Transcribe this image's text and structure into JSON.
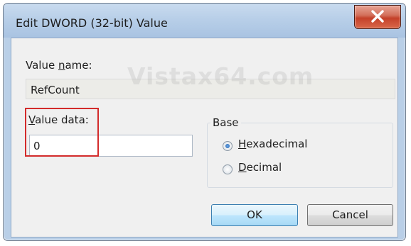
{
  "dialog": {
    "title": "Edit DWORD (32-bit) Value",
    "close_icon": "close-x-icon"
  },
  "value_name": {
    "label_pre": "Value ",
    "label_u": "n",
    "label_post": "ame:",
    "value": "RefCount"
  },
  "watermark": "Vistax64.com",
  "value_data": {
    "label_u": "V",
    "label_post": "alue data:",
    "value": "0"
  },
  "base": {
    "legend": "Base",
    "options": [
      {
        "u": "H",
        "rest": "exadecimal",
        "checked": true
      },
      {
        "u": "D",
        "rest": "ecimal",
        "checked": false
      }
    ]
  },
  "buttons": {
    "ok": "OK",
    "cancel": "Cancel"
  },
  "colors": {
    "frame": "#b9cfe7",
    "close_button": "#c4412a",
    "highlight": "#d32b2b"
  }
}
